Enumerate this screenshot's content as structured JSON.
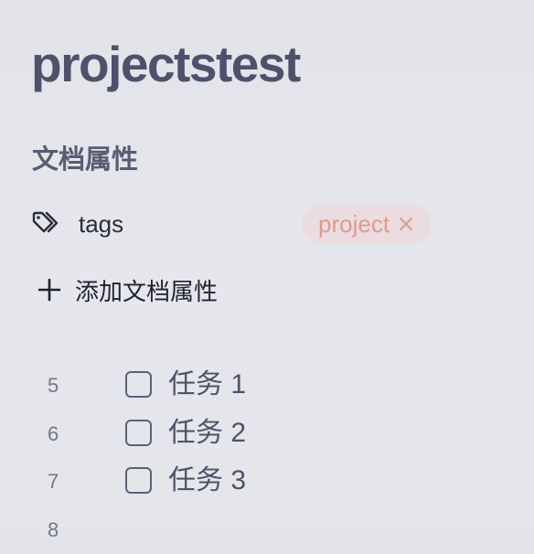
{
  "document": {
    "title": "projectstest"
  },
  "properties": {
    "heading": "文档属性",
    "items": [
      {
        "icon": "tag-icon",
        "name": "tags",
        "tags": [
          {
            "label": "project",
            "color": "#dc9c90",
            "background": "#ebdcdf"
          }
        ]
      }
    ],
    "add_label": "添加文档属性"
  },
  "tasks": [
    {
      "line": "5",
      "text": "任务 1",
      "checked": false
    },
    {
      "line": "6",
      "text": "任务 2",
      "checked": false
    },
    {
      "line": "7",
      "text": "任务 3",
      "checked": false
    },
    {
      "line": "8",
      "text": "",
      "checked": null
    }
  ],
  "colors": {
    "title": "#4f516c",
    "heading": "#595c72",
    "text": "#2a2c3a",
    "muted": "#74778a",
    "tag_text": "#dc9c90",
    "tag_bg": "#ebdcdf"
  }
}
